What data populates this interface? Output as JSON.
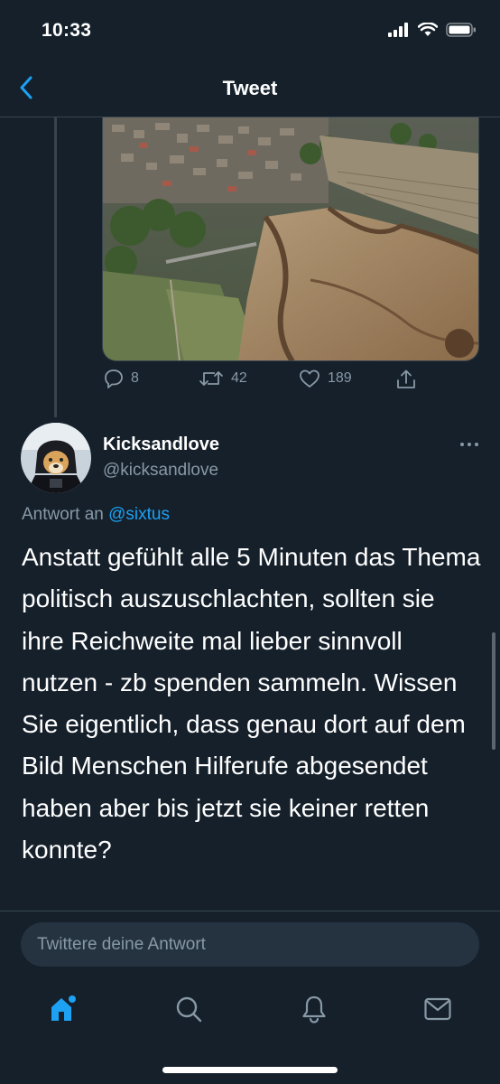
{
  "status_bar": {
    "time": "10:33"
  },
  "nav": {
    "title": "Tweet"
  },
  "parent_tweet": {
    "actions": {
      "replies": "8",
      "retweets": "42",
      "likes": "189"
    }
  },
  "reply_tweet": {
    "author_name": "Kicksandlove",
    "author_handle": "@kicksandlove",
    "reply_prefix": "Antwort an",
    "reply_mention": "@sixtus",
    "text": "Anstatt gefühlt alle 5 Minuten das Thema politisch auszuschlachten, sollten sie ihre Reichweite mal lieber sinnvoll nutzen - zb spenden sammeln. Wissen Sie eigentlich, dass genau dort auf dem Bild Menschen Hilferufe abgesendet haben aber bis jetzt sie keiner retten konnte?"
  },
  "compose": {
    "placeholder": "Twittere deine Antwort"
  },
  "tabs": {
    "home_icon": "home-icon",
    "search_icon": "search-icon",
    "notifications_icon": "bell-icon",
    "messages_icon": "mail-icon"
  },
  "colors": {
    "background": "#15202b",
    "accent": "#1da1f2",
    "secondary_text": "#8899a6",
    "border": "#38444d"
  }
}
